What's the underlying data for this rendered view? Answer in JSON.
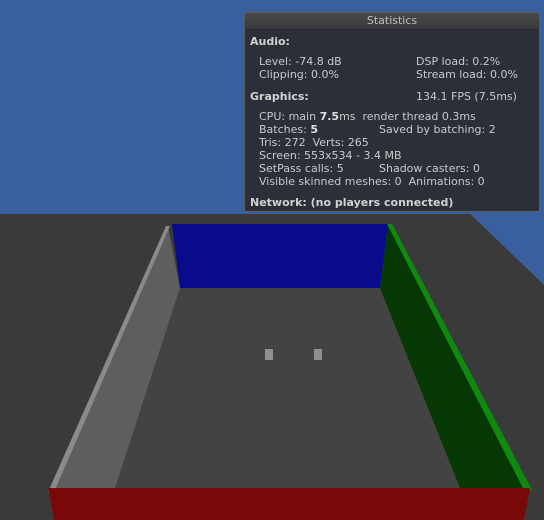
{
  "panel": {
    "title": "Statistics",
    "audio": {
      "header": "Audio:",
      "level": "Level: -74.8 dB",
      "dsp_load": "DSP load: 0.2%",
      "clipping": "Clipping: 0.0%",
      "stream_load": "Stream load: 0.0%"
    },
    "graphics": {
      "header": "Graphics:",
      "fps": "134.1 FPS (7.5ms)",
      "cpu_prefix": "CPU: main ",
      "cpu_main": "7.5",
      "cpu_suffix": "ms  render thread 0.3ms",
      "batches_prefix": "Batches: ",
      "batches": "5",
      "saved_by_batching": "Saved by batching: 2",
      "tris_verts": "Tris: 272  Verts: 265",
      "screen": "Screen: 553x534 - 3.4 MB",
      "setpass": "SetPass calls: 5",
      "shadow_casters": "Shadow casters: 0",
      "visible_skinned": "Visible skinned meshes: 0  Animations: 0"
    },
    "network": "Network: (no players connected)"
  },
  "scene": {
    "sky_color": "#3a5f9e",
    "floor_color": "#3d3b3b",
    "back_wall_color": "#0a0a8c",
    "right_wall_color": "#063806",
    "right_wall_edge_color": "#0f8a0f",
    "left_wall_color": "#5e5e5e",
    "front_wall_color": "#7a0808"
  }
}
